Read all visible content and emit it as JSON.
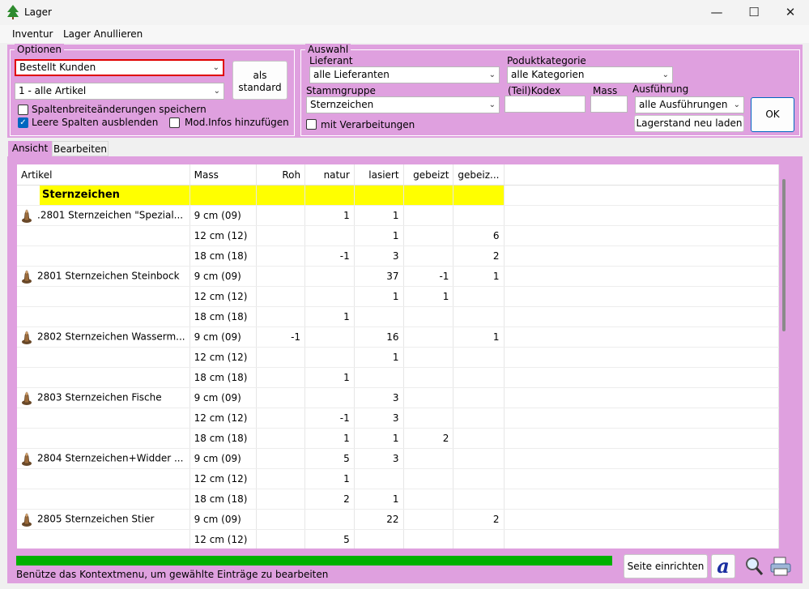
{
  "window": {
    "title": "Lager",
    "app_icon": "tree-icon",
    "controls": [
      "minimize-icon",
      "maximize-icon",
      "close-icon"
    ]
  },
  "menu": {
    "items": [
      "Inventur",
      "Lager Anullieren"
    ]
  },
  "optionen": {
    "label": "Optionen",
    "select1": "Bestellt Kunden",
    "select2": "1 - alle Artikel",
    "als_standard": [
      "als",
      "standard"
    ],
    "chk_spalten": {
      "label": "Spaltenbreiteänderungen speichern",
      "checked": false
    },
    "chk_leere": {
      "label": "Leere Spalten ausblenden",
      "checked": true
    },
    "chk_mod": {
      "label": "Mod.Infos hinzufügen",
      "checked": false
    }
  },
  "auswahl": {
    "label": "Auswahl",
    "lieferant_label": "Lieferant",
    "lieferant_value": "alle Lieferanten",
    "kategorie_label": "Poduktkategorie",
    "kategorie_value": "alle Kategorien",
    "stammgruppe_label": "Stammgruppe",
    "stammgruppe_value": "Sternzeichen",
    "kodex_label": "(Teil)Kodex",
    "mass_label": "Mass",
    "ausfuehrung_label": "Ausführung",
    "ausfuehrung_value": "alle Ausführungen",
    "verarbeitungen_label": "mit Verarbeitungen",
    "verarbeitungen_checked": false,
    "lagerstand_button": "Lagerstand neu laden",
    "ok_button": "OK"
  },
  "tabs": [
    "Ansicht",
    "Bearbeiten"
  ],
  "grid": {
    "columns": [
      "Artikel",
      "Mass",
      "Roh",
      "natur",
      "lasiert",
      "gebeizt",
      "gebeiz..."
    ],
    "group": "Sternzeichen",
    "rows": [
      {
        "artikel": ".2801 Sternzeichen \"Spezial...",
        "icon": "figurine-thumbnail",
        "mass": "9 cm (09)",
        "roh": "",
        "natur": "1",
        "lasiert": "1",
        "gebeizt": "",
        "gebeiz2": ""
      },
      {
        "artikel": "",
        "mass": "12 cm (12)",
        "roh": "",
        "natur": "",
        "lasiert": "1",
        "gebeizt": "",
        "gebeiz2": "6"
      },
      {
        "artikel": "",
        "mass": "18 cm (18)",
        "roh": "",
        "natur": "-1",
        "lasiert": "3",
        "gebeizt": "",
        "gebeiz2": "2"
      },
      {
        "artikel": "2801 Sternzeichen Steinbock",
        "icon": "figurine-thumbnail",
        "mass": "9 cm (09)",
        "roh": "",
        "natur": "",
        "lasiert": "37",
        "gebeizt": "-1",
        "gebeiz2": "1"
      },
      {
        "artikel": "",
        "mass": "12 cm (12)",
        "roh": "",
        "natur": "",
        "lasiert": "1",
        "gebeizt": "1",
        "gebeiz2": ""
      },
      {
        "artikel": "",
        "mass": "18 cm (18)",
        "roh": "",
        "natur": "1",
        "lasiert": "",
        "gebeizt": "",
        "gebeiz2": ""
      },
      {
        "artikel": "2802 Sternzeichen Wasserm...",
        "icon": "figurine-thumbnail",
        "mass": "9 cm (09)",
        "roh": "-1",
        "natur": "",
        "lasiert": "16",
        "gebeizt": "",
        "gebeiz2": "1"
      },
      {
        "artikel": "",
        "mass": "12 cm (12)",
        "roh": "",
        "natur": "",
        "lasiert": "1",
        "gebeizt": "",
        "gebeiz2": ""
      },
      {
        "artikel": "",
        "mass": "18 cm (18)",
        "roh": "",
        "natur": "1",
        "lasiert": "",
        "gebeizt": "",
        "gebeiz2": ""
      },
      {
        "artikel": "2803 Sternzeichen Fische",
        "icon": "figurine-thumbnail",
        "mass": "9 cm (09)",
        "roh": "",
        "natur": "",
        "lasiert": "3",
        "gebeizt": "",
        "gebeiz2": ""
      },
      {
        "artikel": "",
        "mass": "12 cm (12)",
        "roh": "",
        "natur": "-1",
        "lasiert": "3",
        "gebeizt": "",
        "gebeiz2": ""
      },
      {
        "artikel": "",
        "mass": "18 cm (18)",
        "roh": "",
        "natur": "1",
        "lasiert": "1",
        "gebeizt": "2",
        "gebeiz2": ""
      },
      {
        "artikel": "2804 Sternzeichen+Widder ...",
        "icon": "figurine-thumbnail",
        "mass": "9 cm (09)",
        "roh": "",
        "natur": "5",
        "lasiert": "3",
        "gebeizt": "",
        "gebeiz2": ""
      },
      {
        "artikel": "",
        "mass": "12 cm (12)",
        "roh": "",
        "natur": "1",
        "lasiert": "",
        "gebeizt": "",
        "gebeiz2": ""
      },
      {
        "artikel": "",
        "mass": "18 cm (18)",
        "roh": "",
        "natur": "2",
        "lasiert": "1",
        "gebeizt": "",
        "gebeiz2": ""
      },
      {
        "artikel": "2805 Sternzeichen Stier",
        "icon": "figurine-thumbnail",
        "mass": "9 cm (09)",
        "roh": "",
        "natur": "",
        "lasiert": "22",
        "gebeizt": "",
        "gebeiz2": "2"
      },
      {
        "artikel": "",
        "mass": "12 cm (12)",
        "roh": "",
        "natur": "5",
        "lasiert": "",
        "gebeizt": "",
        "gebeiz2": ""
      }
    ]
  },
  "footer": {
    "status": "Benütze das Kontextmenu, um gewählte Einträge zu bearbeiten",
    "seite_button": "Seite einrichten",
    "progress_percent": 100,
    "progress_color": "#00b000"
  },
  "colors": {
    "panel": "#dfa0df",
    "group_highlight": "#ffff00",
    "select_border": "#e00000",
    "accent": "#0067c0"
  }
}
